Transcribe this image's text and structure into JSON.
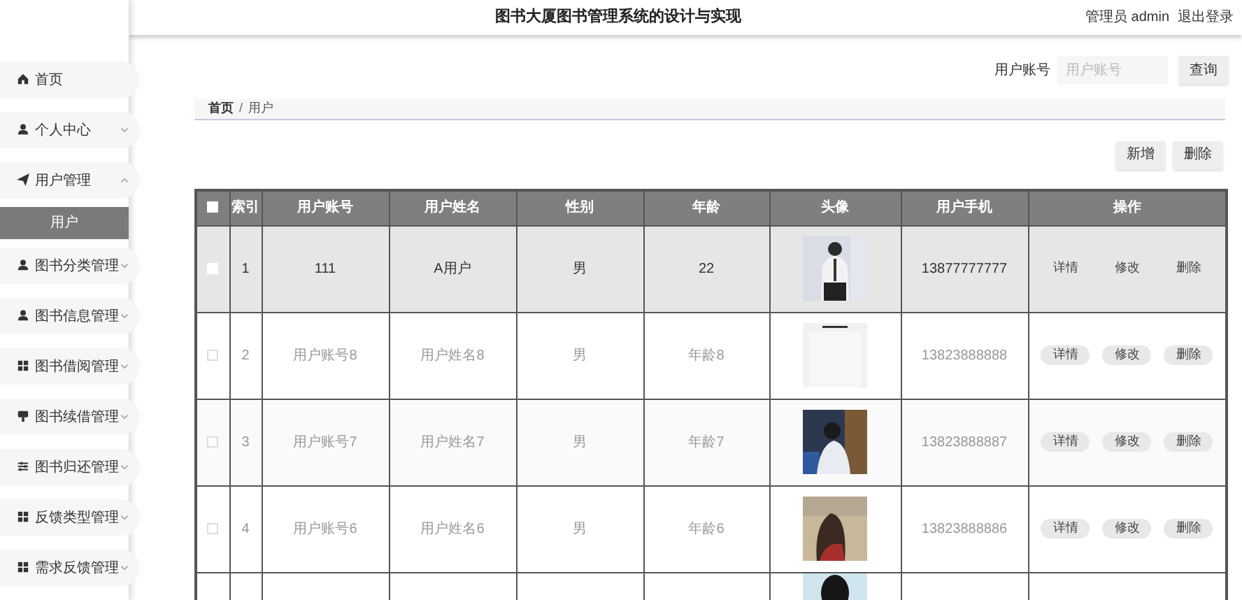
{
  "header": {
    "title": "图书大厦图书管理系统的设计与实现",
    "user": "管理员 admin",
    "logout": "退出登录"
  },
  "sidebar": {
    "items": [
      {
        "label": "首页"
      },
      {
        "label": "个人中心",
        "expanded": false
      },
      {
        "label": "用户管理",
        "expanded": true,
        "children": [
          {
            "label": "用户",
            "selected": true
          }
        ]
      },
      {
        "label": "图书分类管理",
        "expanded": false
      },
      {
        "label": "图书信息管理",
        "expanded": false
      },
      {
        "label": "图书借阅管理",
        "expanded": false
      },
      {
        "label": "图书续借管理",
        "expanded": false
      },
      {
        "label": "图书归还管理",
        "expanded": false
      },
      {
        "label": "反馈类型管理",
        "expanded": false
      },
      {
        "label": "需求反馈管理",
        "expanded": false
      }
    ]
  },
  "search": {
    "label": "用户账号",
    "placeholder": "用户账号",
    "button": "查询"
  },
  "breadcrumb": [
    "首页",
    "用户"
  ],
  "breadcrumb_separator": "/",
  "actions": [
    "新增",
    "删除"
  ],
  "table": {
    "all_checked": false,
    "columns": [
      "索引",
      "用户账号",
      "用户姓名",
      "性别",
      "年龄",
      "头像",
      "用户手机",
      "操作"
    ],
    "rows": [
      {
        "checked": false,
        "hovered": true,
        "cells": [
          "1",
          "111",
          "A用户",
          "男",
          "22"
        ],
        "avatar": {
          "kind": "picture"
        },
        "phone": "13877777777",
        "buttons": [
          "详情",
          "修改",
          "删除"
        ]
      },
      {
        "checked": false,
        "hovered": false,
        "cells": [
          "2",
          "用户账号8",
          "用户姓名8",
          "男",
          "年龄8"
        ],
        "avatar": {
          "kind": "picture"
        },
        "phone": "13823888888",
        "buttons": [
          "详情",
          "修改",
          "删除"
        ]
      },
      {
        "checked": false,
        "hovered": false,
        "cells": [
          "3",
          "用户账号7",
          "用户姓名7",
          "男",
          "年龄7"
        ],
        "avatar": {
          "kind": "picture"
        },
        "phone": "13823888887",
        "buttons": [
          "详情",
          "修改",
          "删除"
        ]
      },
      {
        "checked": false,
        "hovered": false,
        "cells": [
          "4",
          "用户账号6",
          "用户姓名6",
          "男",
          "年龄6"
        ],
        "avatar": {
          "kind": "picture"
        },
        "phone": "13823888886",
        "buttons": [
          "详情",
          "修改",
          "删除"
        ]
      }
    ],
    "partial_row": {
      "avatar": {
        "kind": "picture"
      }
    }
  }
}
